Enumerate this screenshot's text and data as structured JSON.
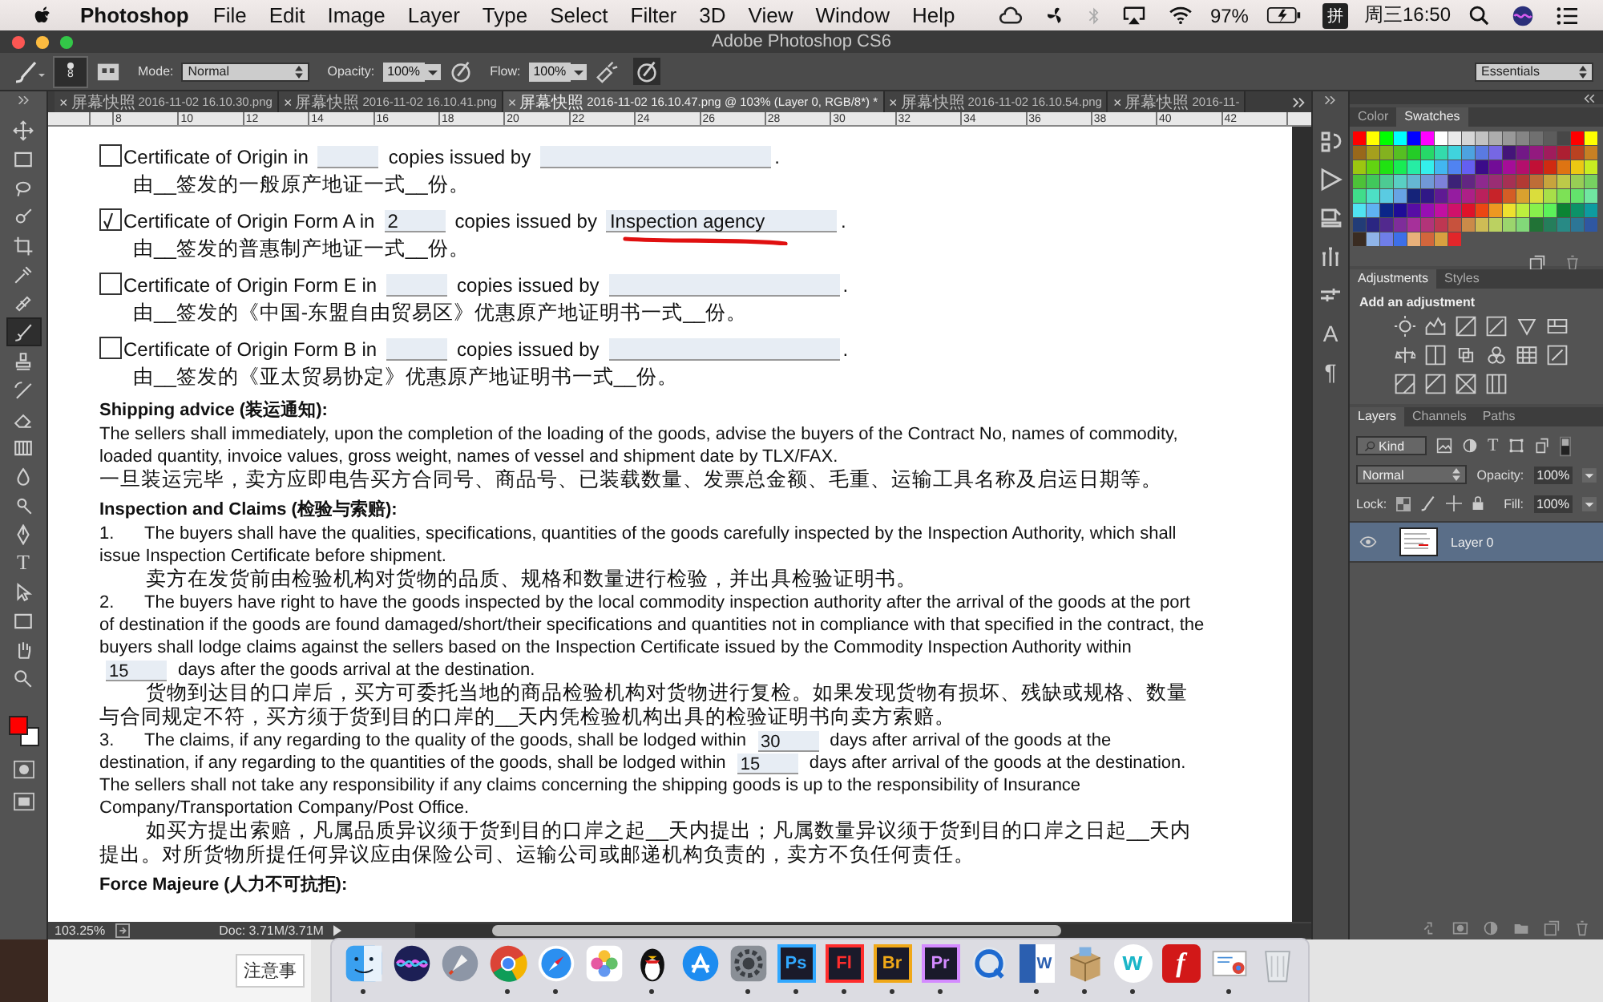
{
  "menubar": {
    "app": "Photoshop",
    "menus": [
      "File",
      "Edit",
      "Image",
      "Layer",
      "Type",
      "Select",
      "Filter",
      "3D",
      "View",
      "Window",
      "Help"
    ],
    "battery": "97%",
    "input_method": "拼",
    "clock": "周三16:50"
  },
  "window": {
    "title": "Adobe Photoshop CS6"
  },
  "options_bar": {
    "brush_size": "8",
    "mode_label": "Mode:",
    "mode": "Normal",
    "opacity_label": "Opacity:",
    "opacity": "100%",
    "flow_label": "Flow:",
    "flow": "100%",
    "workspace": "Essentials"
  },
  "tools": [
    {
      "kind": "move",
      "selected": false
    },
    {
      "kind": "marquee",
      "selected": false
    },
    {
      "kind": "lasso",
      "selected": false
    },
    {
      "kind": "quick-select",
      "selected": false
    },
    {
      "kind": "crop",
      "selected": false
    },
    {
      "kind": "eyedropper",
      "selected": false
    },
    {
      "kind": "heal",
      "selected": false
    },
    {
      "kind": "brush",
      "selected": true
    },
    {
      "kind": "stamp",
      "selected": false
    },
    {
      "kind": "history-brush",
      "selected": false
    },
    {
      "kind": "eraser",
      "selected": false
    },
    {
      "kind": "gradient",
      "selected": false
    },
    {
      "kind": "blur",
      "selected": false
    },
    {
      "kind": "dodge",
      "selected": false
    },
    {
      "kind": "pen",
      "selected": false
    },
    {
      "kind": "type",
      "label": "T",
      "selected": false
    },
    {
      "kind": "path-select",
      "selected": false
    },
    {
      "kind": "shape",
      "selected": false
    },
    {
      "kind": "hand",
      "selected": false
    },
    {
      "kind": "zoom",
      "selected": false
    }
  ],
  "tabs": [
    {
      "close": "×",
      "label_cn": "屏幕快照",
      "label": "2016-11-02 16.10.30.png",
      "selected": false
    },
    {
      "close": "×",
      "label_cn": "屏幕快照",
      "label": "2016-11-02 16.10.41.png",
      "selected": false
    },
    {
      "close": "×",
      "label_cn": "屏幕快照",
      "label": "2016-11-02 16.10.47.png @ 103% (Layer 0, RGB/8*) *",
      "selected": true
    },
    {
      "close": "×",
      "label_cn": "屏幕快照",
      "label": "2016-11-02 16.10.54.png",
      "selected": false
    },
    {
      "close": "×",
      "label_cn": "屏幕快照",
      "label": "2016-11-",
      "selected": false
    }
  ],
  "ruler": {
    "ticks": [
      "8",
      "10",
      "12",
      "14",
      "16",
      "18",
      "20",
      "22",
      "24",
      "26",
      "28",
      "30",
      "32",
      "34",
      "36",
      "38",
      "40",
      "42"
    ]
  },
  "document": {
    "certificates": [
      {
        "checked": false,
        "annotated": false,
        "title": "Certificate of Origin in",
        "issued_label": "copies issued by",
        "end": ".",
        "note": "由__签发的一般原产地证一式__份。"
      },
      {
        "checked": true,
        "annotated": true,
        "title": "Certificate of Origin Form A in",
        "copies": "2",
        "issued_label": "copies issued by",
        "issuer": "Inspection agency",
        "end": ".",
        "note": "由__签发的普惠制产地证一式__份。"
      },
      {
        "checked": false,
        "annotated": false,
        "title": "Certificate of Origin Form E in",
        "issued_label": "copies issued by",
        "end": ".",
        "note": "由__签发的《中国-东盟自由贸易区》优惠原产地证明书一式__份。"
      },
      {
        "checked": false,
        "annotated": false,
        "title": "Certificate of Origin Form B in",
        "issued_label": "copies issued by",
        "end": ".",
        "note": "由__签发的《亚太贸易协定》优惠原产地证明书一式__份。"
      }
    ],
    "sections": [
      {
        "kind": "heading",
        "text": "Shipping advice (装运通知):"
      },
      {
        "kind": "para",
        "text": "The sellers shall immediately, upon the completion of the loading of the goods, advise the buyers of the Contract No, names of commodity, loaded quantity, invoice values, gross weight, names of vessel and shipment date by TLX/FAX."
      },
      {
        "kind": "cn",
        "indent": false,
        "text": "一旦装运完毕，卖方应即电告买方合同号、商品号、已装载数量、发票总金额、毛重、运输工具名称及启运日期等。"
      },
      {
        "kind": "heading",
        "text": "Inspection and Claims (检验与索赔):"
      },
      {
        "kind": "clause",
        "number": "1.",
        "parts": [
          {
            "kind": "text",
            "text": "The buyers shall have the qualities, specifications, quantities of the goods carefully inspected by the Inspection Authority, which shall issue Inspection Certificate before shipment."
          }
        ]
      },
      {
        "kind": "cn",
        "indent": true,
        "text": "卖方在发货前由检验机构对货物的品质、规格和数量进行检验，并出具检验证明书。"
      },
      {
        "kind": "clause",
        "number": "2.",
        "parts": [
          {
            "kind": "text",
            "text": "The buyers have right to have the goods inspected by the local commodity inspection authority after the arrival of the goods at the port of destination if the goods are found damaged/short/their specifications and quantities not in compliance with that specified in the contract, the buyers shall lodge claims against the sellers based on the Inspection Certificate issued by the Commodity Inspection Authority within"
          },
          {
            "kind": "field",
            "value": "15"
          },
          {
            "kind": "text",
            "text": "days after the goods arrival at the destination."
          }
        ]
      },
      {
        "kind": "cn",
        "indent": true,
        "text": "货物到达目的口岸后，买方可委托当地的商品检验机构对货物进行复检。如果发现货物有损坏、残缺或规格、数量与合同规定不符，买方须于货到目的口岸的__天内凭检验机构出具的检验证明书向卖方索赔。"
      },
      {
        "kind": "clause",
        "number": "3.",
        "parts": [
          {
            "kind": "text",
            "text": "The claims, if any regarding to the quality of the goods, shall be lodged within"
          },
          {
            "kind": "field",
            "value": "30"
          },
          {
            "kind": "text",
            "text": "days after arrival of the goods at the destination, if any regarding to the quantities of the goods, shall be lodged within"
          },
          {
            "kind": "field",
            "value": "15"
          },
          {
            "kind": "text",
            "text": "days after arrival of the goods at the destination. The sellers shall not take any responsibility if any claims concerning the shipping goods is up to the responsibility of Insurance Company/Transportation Company/Post Office."
          }
        ]
      },
      {
        "kind": "cn",
        "indent": true,
        "text": "如买方提出索赔，凡属品质异议须于货到目的口岸之起__天内提出；凡属数量异议须于货到目的口岸之日起__天内提出。对所货物所提任何异议应由保险公司、运输公司或邮递机构负责的，卖方不负任何责任。"
      },
      {
        "kind": "heading",
        "text": "Force Majeure (人力不可抗拒):"
      }
    ]
  },
  "status_bar": {
    "zoom": "103.25%",
    "doc": "Doc: 3.71M/3.71M"
  },
  "side_strip": [
    {
      "kind": "history"
    },
    {
      "kind": "actions"
    },
    {
      "kind": "properties"
    },
    {
      "kind": "brushes"
    },
    {
      "kind": "clone"
    },
    {
      "kind": "glyph",
      "label": "A"
    },
    {
      "kind": "glyph",
      "label": "¶"
    }
  ],
  "panels": {
    "color_tabs": [
      {
        "label": "Color",
        "selected": false
      },
      {
        "label": "Swatches",
        "selected": true
      }
    ],
    "adjust_tabs": [
      {
        "label": "Adjustments",
        "selected": true
      },
      {
        "label": "Styles",
        "selected": false
      }
    ],
    "adjust_hint": "Add an adjustment",
    "layer_tabs": [
      {
        "label": "Layers",
        "selected": true
      },
      {
        "label": "Channels",
        "selected": false
      },
      {
        "label": "Paths",
        "selected": false
      }
    ],
    "filter": "Kind",
    "type_glyph": "T",
    "blend": "Normal",
    "opacity_label": "Opacity:",
    "opacity": "100%",
    "lock_label": "Lock:",
    "fill_label": "Fill:",
    "fill": "100%",
    "layers": [
      {
        "name": "Layer 0",
        "selected": true,
        "visible": true
      }
    ]
  },
  "desktop": {
    "text": "注意事"
  },
  "dock": [
    {
      "kind": "finder",
      "running": true
    },
    {
      "kind": "siri",
      "running": false
    },
    {
      "kind": "rocket",
      "running": false
    },
    {
      "kind": "chrome",
      "running": true
    },
    {
      "kind": "compass",
      "running": true
    },
    {
      "kind": "flower",
      "running": false
    },
    {
      "kind": "penguin",
      "running": true
    },
    {
      "kind": "appstore",
      "running": false
    },
    {
      "kind": "gear",
      "running": true
    },
    {
      "kind": "letter",
      "label": "Ps",
      "color": "#31a8ff",
      "running": true
    },
    {
      "kind": "letter",
      "label": "Fl",
      "color": "#ff2d2d",
      "running": true
    },
    {
      "kind": "letter",
      "label": "Br",
      "color": "#f0a818",
      "running": true
    },
    {
      "kind": "letter",
      "label": "Pr",
      "color": "#d48bff",
      "running": true
    },
    {
      "kind": "quicktime",
      "running": false
    },
    {
      "kind": "word",
      "label": "W",
      "running": true
    },
    {
      "kind": "box",
      "running": true
    },
    {
      "kind": "circle-letter",
      "label": "w",
      "running": true
    },
    {
      "kind": "flash",
      "label": "f",
      "running": false
    },
    {
      "kind": "preview",
      "running": true
    },
    {
      "kind": "trash",
      "running": false
    }
  ]
}
